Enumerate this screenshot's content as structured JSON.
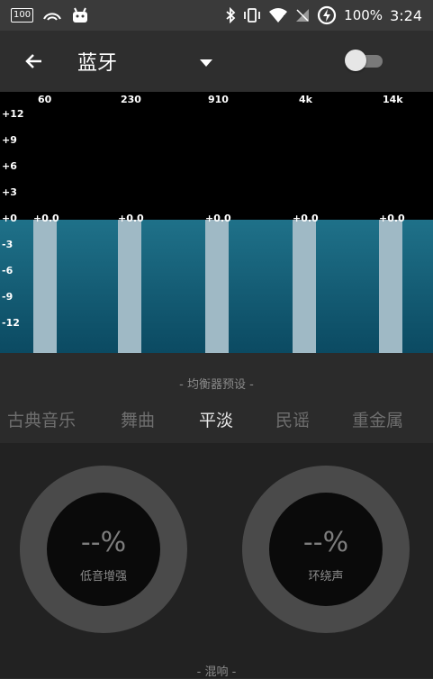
{
  "status_bar": {
    "battery_small": "100",
    "battery_percent": "100%",
    "time": "3:24"
  },
  "app_bar": {
    "title": "蓝牙"
  },
  "equalizer": {
    "frequencies": [
      "60",
      "230",
      "910",
      "4k",
      "14k"
    ],
    "db_scale": [
      "+12",
      "+9",
      "+6",
      "+3",
      "+0",
      "-3",
      "-6",
      "-9",
      "-12"
    ],
    "band_values": [
      "+0.0",
      "+0.0",
      "+0.0",
      "+0.0",
      "+0.0"
    ]
  },
  "presets": {
    "title": "- 均衡器预设 -",
    "items": [
      "古典音乐",
      "舞曲",
      "平淡",
      "民谣",
      "重金属"
    ],
    "selected": "平淡"
  },
  "effects": {
    "bass_boost": {
      "value": "--%",
      "label": "低音增强"
    },
    "surround": {
      "value": "--%",
      "label": "环绕声"
    },
    "reverb_title": "- 混响 -"
  },
  "colors": {
    "eq_fill_top": "#1f7189",
    "eq_fill_bottom": "#0b4a62",
    "band": "#9fb9c5"
  }
}
